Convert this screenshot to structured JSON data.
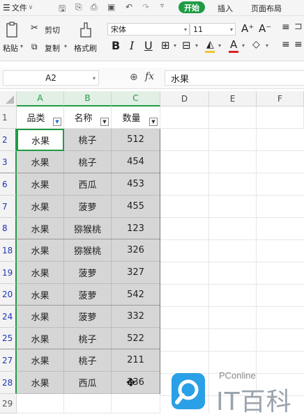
{
  "menubar": {
    "file_label": "文件",
    "tabs": [
      "插入",
      "页面布局"
    ],
    "active_tab": "开始"
  },
  "ribbon": {
    "paste_label": "粘贴",
    "cut_label": "剪切",
    "copy_label": "复制",
    "format_painter_label": "格式刷",
    "font_name": "宋体",
    "font_size": "11"
  },
  "formula_bar": {
    "cell_ref": "A2",
    "formula_value": "水果"
  },
  "columns": [
    "A",
    "B",
    "C",
    "D",
    "E",
    "F"
  ],
  "header_row": {
    "row_number": "1",
    "cells": [
      "品类",
      "名称",
      "数量"
    ]
  },
  "rows": [
    {
      "row_number": "2",
      "values": [
        "水果",
        "桃子",
        "512"
      ]
    },
    {
      "row_number": "3",
      "values": [
        "水果",
        "桃子",
        "454"
      ]
    },
    {
      "row_number": "6",
      "values": [
        "水果",
        "西瓜",
        "453"
      ]
    },
    {
      "row_number": "7",
      "values": [
        "水果",
        "菠萝",
        "455"
      ]
    },
    {
      "row_number": "8",
      "values": [
        "水果",
        "猕猴桃",
        "123"
      ]
    },
    {
      "row_number": "18",
      "values": [
        "水果",
        "猕猴桃",
        "326"
      ]
    },
    {
      "row_number": "19",
      "values": [
        "水果",
        "菠萝",
        "327"
      ]
    },
    {
      "row_number": "20",
      "values": [
        "水果",
        "菠萝",
        "542"
      ]
    },
    {
      "row_number": "24",
      "values": [
        "水果",
        "菠萝",
        "332"
      ]
    },
    {
      "row_number": "25",
      "values": [
        "水果",
        "桃子",
        "522"
      ]
    },
    {
      "row_number": "27",
      "values": [
        "水果",
        "桃子",
        "211"
      ]
    },
    {
      "row_number": "28",
      "values": [
        "水果",
        "西瓜",
        "336"
      ]
    }
  ],
  "trailing_row": "29",
  "watermark": {
    "brand": "PConline",
    "name": "IT百科"
  },
  "colors": {
    "accent": "#1e9b45",
    "row_number": "#1f35b5",
    "selected_cell_fill": "#d6d6d6"
  }
}
